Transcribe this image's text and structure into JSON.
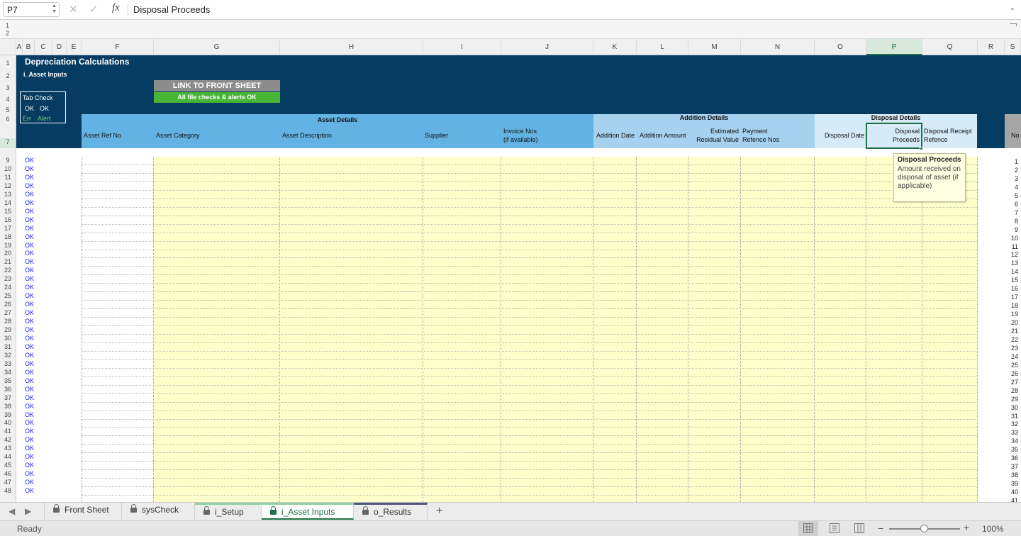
{
  "formula_bar": {
    "name_box": "P7",
    "fx_label": "fx",
    "content": "Disposal Proceeds"
  },
  "outline_levels": [
    "1",
    "2"
  ],
  "columns": [
    "A",
    "B",
    "C",
    "D",
    "E",
    "F",
    "G",
    "H",
    "I",
    "J",
    "K",
    "L",
    "M",
    "N",
    "O",
    "P",
    "Q",
    "R",
    "S"
  ],
  "selected_column": "P",
  "rows": [
    "1",
    "2",
    "3",
    "4",
    "5",
    "6",
    "7",
    "9",
    "10",
    "11",
    "12",
    "13",
    "14",
    "15",
    "16",
    "17",
    "18",
    "19",
    "20",
    "21",
    "22",
    "23",
    "24",
    "25",
    "26",
    "27",
    "28",
    "29",
    "30",
    "31",
    "32",
    "33",
    "34",
    "35",
    "36",
    "37",
    "38",
    "39",
    "40",
    "41",
    "42",
    "43",
    "44",
    "45",
    "46",
    "47",
    "48"
  ],
  "selected_row": "7",
  "sheet": {
    "title": "Depreciation Calculations",
    "subtitle": "i_Asset Inputs",
    "tab_check": {
      "title": "Tab Check",
      "ok1": "OK",
      "ok2": "OK",
      "err": "Err",
      "alert": "Alert"
    },
    "link_button": "LINK TO FRONT SHEET",
    "checks_status": "All file checks & alerts OK"
  },
  "groups": {
    "asset": {
      "title": "Asset Details",
      "headers": {
        "ref": "Asset Ref No",
        "category": "Asset Category",
        "description": "Asset Description",
        "supplier": "Supplier",
        "invoice_1": "Invoice Nos",
        "invoice_2": "(if available)"
      }
    },
    "addition": {
      "title": "Addition Details",
      "headers": {
        "date": "Addition Date",
        "amount": "Addition Amount",
        "residual_1": "Estimated",
        "residual_2": "Residual Value",
        "payment_1": "Payment",
        "payment_2": "Refence Nos"
      }
    },
    "disposal": {
      "title": "Disposal Details",
      "headers": {
        "date": "Disposal Date",
        "proceeds_1": "Disposal",
        "proceeds_2": "Proceeds",
        "receipt_1": "Disposal Receipt",
        "receipt_2": "Refence"
      }
    },
    "no_header": "No"
  },
  "row_status": [
    "OK",
    "OK",
    "OK",
    "OK",
    "OK",
    "OK",
    "OK",
    "OK",
    "OK",
    "OK",
    "OK",
    "OK",
    "OK",
    "OK",
    "OK",
    "OK",
    "OK",
    "OK",
    "OK",
    "OK",
    "OK",
    "OK",
    "OK",
    "OK",
    "OK",
    "OK",
    "OK",
    "OK",
    "OK",
    "OK",
    "OK",
    "OK",
    "OK",
    "OK",
    "OK",
    "OK",
    "OK",
    "OK",
    "OK",
    "OK"
  ],
  "row_numbers": [
    "1",
    "2",
    "3",
    "4",
    "5",
    "6",
    "7",
    "8",
    "9",
    "10",
    "11",
    "12",
    "13",
    "14",
    "15",
    "16",
    "17",
    "18",
    "19",
    "20",
    "21",
    "22",
    "23",
    "24",
    "25",
    "26",
    "27",
    "28",
    "29",
    "30",
    "31",
    "32",
    "33",
    "34",
    "35",
    "36",
    "37",
    "38",
    "39",
    "40",
    "41"
  ],
  "comment": {
    "title": "Disposal Proceeds",
    "body": "Amount received on disposal of asset (if applicable)"
  },
  "sheet_tabs": [
    {
      "label": "Front Sheet",
      "active": false
    },
    {
      "label": "sysCheck",
      "active": false
    },
    {
      "label": "i_Setup",
      "active": false
    },
    {
      "label": "i_Asset Inputs",
      "active": true
    },
    {
      "label": "o_Results",
      "active": false
    }
  ],
  "add_tab": "+",
  "status": {
    "text": "Ready",
    "zoom_minus": "−",
    "zoom_plus": "+",
    "zoom": "100%",
    "zoom_fraction": 0.5
  },
  "colors": {
    "header_dark": "#063c62",
    "asset_group": "#62b3e3",
    "addition_group": "#a6d1ef",
    "disposal_group": "#d6eaf8",
    "input_fill": "#ffffcc",
    "ok_text": "#1a1aff",
    "selection": "#1e7145",
    "link_button": "#8c8c8c",
    "checks_ok": "#47b535"
  }
}
